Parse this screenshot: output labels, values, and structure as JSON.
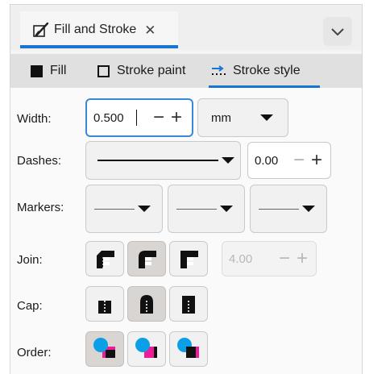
{
  "dock": {
    "tab_label": "Fill and Stroke",
    "close_glyph": "✕",
    "menu_icon": "chevron-down-icon"
  },
  "tabs": [
    {
      "label": "Fill",
      "icon": "filled-square-icon",
      "active": false
    },
    {
      "label": "Stroke paint",
      "icon": "outline-square-icon",
      "active": false
    },
    {
      "label": "Stroke style",
      "icon": "stroke-style-icon",
      "active": true
    }
  ],
  "stroke_style": {
    "width": {
      "label": "Width:",
      "value": "0.500",
      "unit": "mm"
    },
    "dashes": {
      "label": "Dashes:",
      "offset": "0.00"
    },
    "markers": {
      "label": "Markers:"
    },
    "join": {
      "label": "Join:",
      "options": [
        "bevel-join-icon",
        "round-join-icon",
        "miter-join-icon"
      ],
      "selected": 1,
      "miter_limit": "4.00"
    },
    "cap": {
      "label": "Cap:",
      "options": [
        "butt-cap-icon",
        "round-cap-icon",
        "square-cap-icon"
      ],
      "selected": 1
    },
    "order": {
      "label": "Order:",
      "options": [
        "fill-stroke-markers-icon",
        "stroke-fill-icon",
        "markers-stroke-fill-icon"
      ],
      "selected": 0
    }
  },
  "colors": {
    "accent": "#1676d2",
    "order_blue": "#0a9fe6",
    "order_pink": "#ee1c9a"
  }
}
